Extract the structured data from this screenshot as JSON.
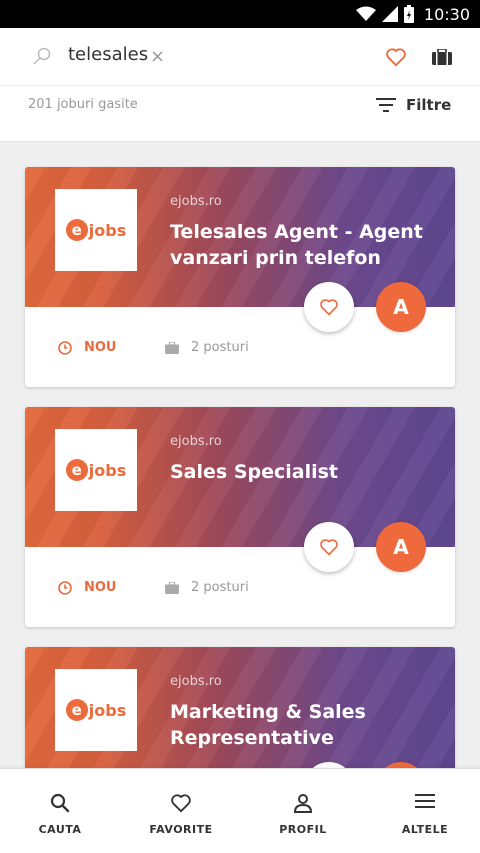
{
  "status_bar": {
    "time": "10:30"
  },
  "search": {
    "query": "telesales",
    "clear_icon": "close-icon"
  },
  "results": {
    "count_text": "201 joburi gasite",
    "filter_label": "Filtre"
  },
  "jobs": [
    {
      "company": "ejobs.ro",
      "title": "Telesales Agent - Agent vanzari prin telefon",
      "status": "NOU",
      "positions": "2 posturi",
      "apply_letter": "A",
      "logo_text": "jobs",
      "logo_letter": "e"
    },
    {
      "company": "ejobs.ro",
      "title": "Sales Specialist",
      "status": "NOU",
      "positions": "2 posturi",
      "apply_letter": "A",
      "logo_text": "jobs",
      "logo_letter": "e"
    },
    {
      "company": "ejobs.ro",
      "title": "Marketing & Sales Representative",
      "status": "",
      "positions": "",
      "apply_letter": "",
      "logo_text": "jobs",
      "logo_letter": "e"
    }
  ],
  "nav": [
    {
      "label": "CAUTA",
      "icon": "search-icon"
    },
    {
      "label": "FAVORITE",
      "icon": "heart-icon"
    },
    {
      "label": "PROFIL",
      "icon": "person-icon"
    },
    {
      "label": "ALTELE",
      "icon": "menu-icon"
    }
  ],
  "colors": {
    "accent": "#ee6a3d",
    "gradient_start": "#e46a3d",
    "gradient_end": "#5e4891"
  }
}
